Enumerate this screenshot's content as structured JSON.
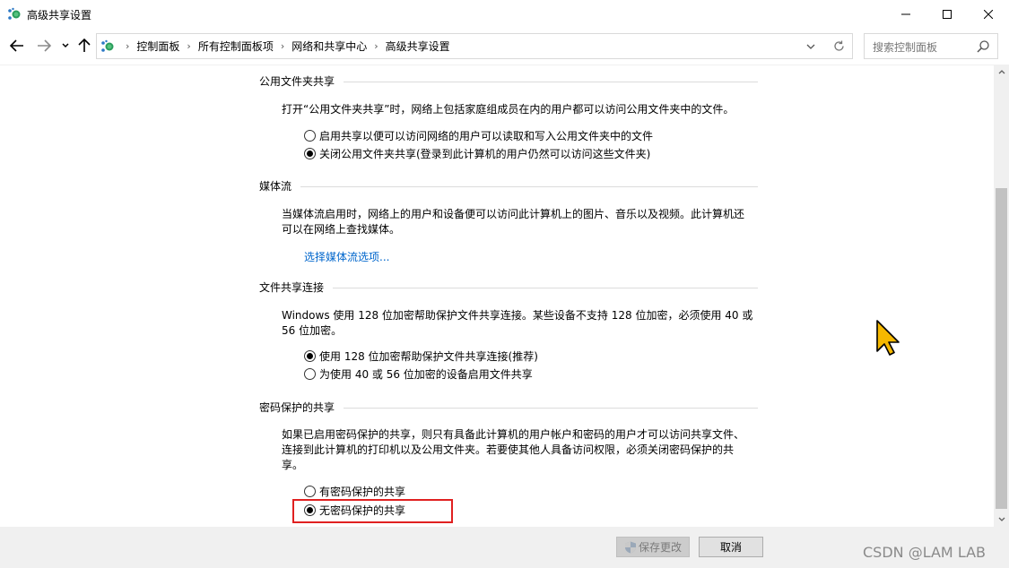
{
  "window": {
    "title": "高级共享设置"
  },
  "nav": {
    "breadcrumbs": [
      "控制面板",
      "所有控制面板项",
      "网络和共享中心",
      "高级共享设置"
    ],
    "search_placeholder": "搜索控制面板"
  },
  "sections": {
    "public_folder": {
      "heading": "公用文件夹共享",
      "description": "打开“公用文件夹共享”时，网络上包括家庭组成员在内的用户都可以访问公用文件夹中的文件。",
      "options": [
        {
          "label": "启用共享以便可以访问网络的用户可以读取和写入公用文件夹中的文件",
          "checked": false
        },
        {
          "label": "关闭公用文件夹共享(登录到此计算机的用户仍然可以访问这些文件夹)",
          "checked": true
        }
      ]
    },
    "media": {
      "heading": "媒体流",
      "description_line1": "当媒体流启用时，网络上的用户和设备便可以访问此计算机上的图片、音乐以及视频。此计算机还",
      "description_line2": "可以在网络上查找媒体。",
      "link": "选择媒体流选项..."
    },
    "file_sharing": {
      "heading": "文件共享连接",
      "description_line1": "Windows 使用 128 位加密帮助保护文件共享连接。某些设备不支持 128 位加密，必须使用 40 或",
      "description_line2": "56 位加密。",
      "options": [
        {
          "label": "使用 128 位加密帮助保护文件共享连接(推荐)",
          "checked": true
        },
        {
          "label": "为使用 40 或 56 位加密的设备启用文件共享",
          "checked": false
        }
      ]
    },
    "password": {
      "heading": "密码保护的共享",
      "description_line1": "如果已启用密码保护的共享，则只有具备此计算机的用户帐户和密码的用户才可以访问共享文件、",
      "description_line2": "连接到此计算机的打印机以及公用文件夹。若要使其他人具备访问权限，必须关闭密码保护的共",
      "description_line3": "享。",
      "options": [
        {
          "label": "有密码保护的共享",
          "checked": false
        },
        {
          "label": "无密码保护的共享",
          "checked": true
        }
      ]
    }
  },
  "footer": {
    "save_label": "保存更改",
    "cancel_label": "取消",
    "watermark": "CSDN @LAM LAB"
  },
  "colors": {
    "link": "#0066cc",
    "highlight": "#e02020"
  }
}
